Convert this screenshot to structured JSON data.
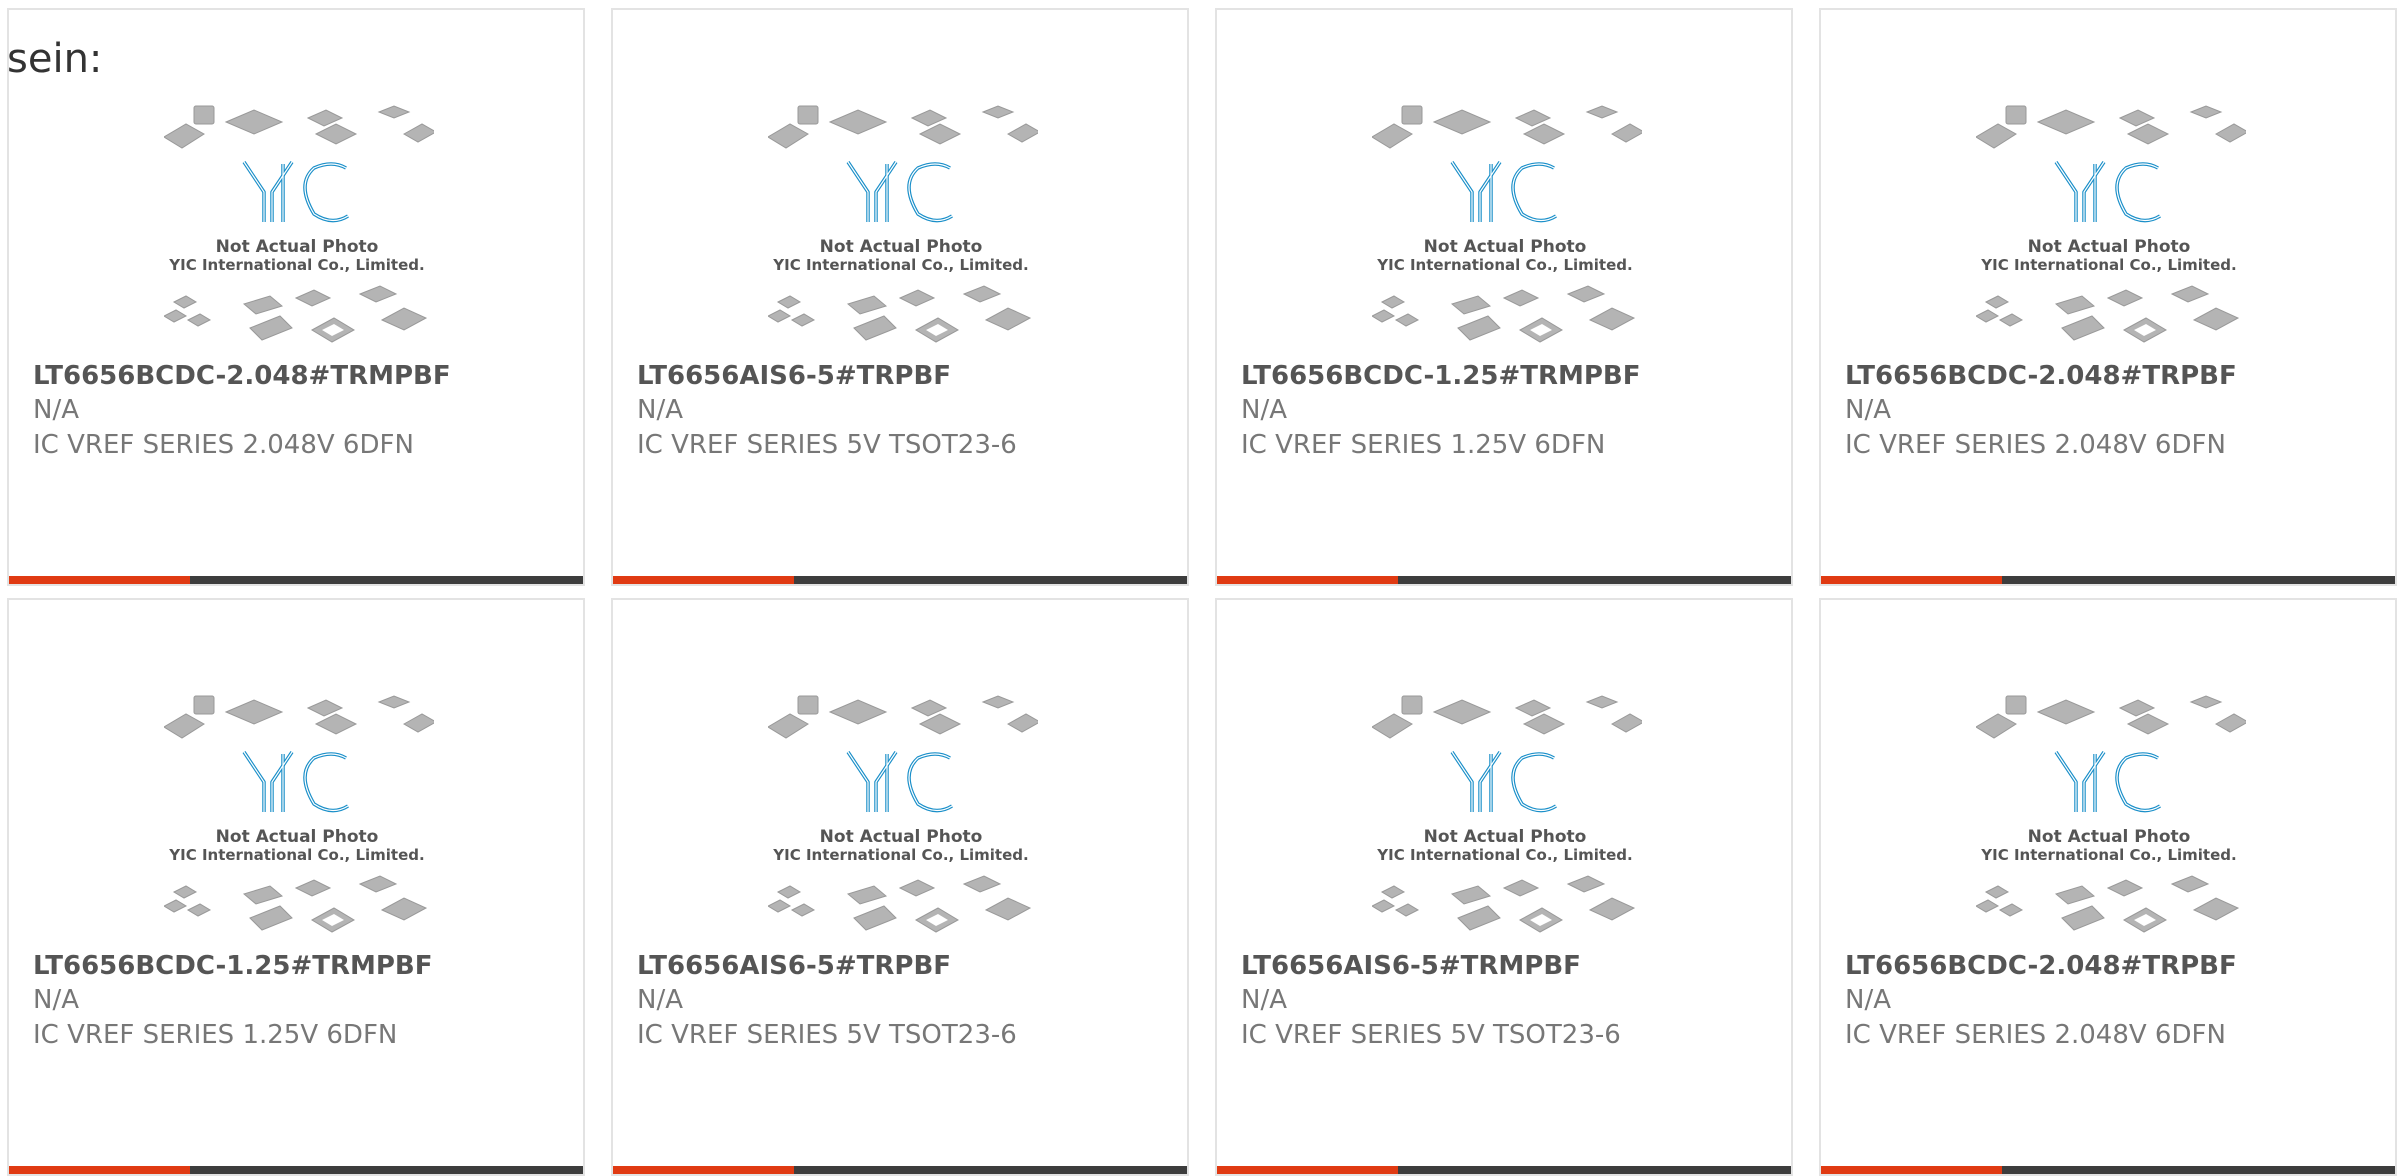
{
  "intro_text": "sein:",
  "photo": {
    "line1": "Not Actual Photo",
    "line2": "YIC International Co., Limited.",
    "logo_text": "YIC",
    "logo_color": "#1a8fc9"
  },
  "colors": {
    "accent": "#e03a12",
    "bar": "#3d3d3d",
    "card_border": "#e3e3e3"
  },
  "products": [
    {
      "part": "LT6656BCDC-2.048#TRMPBF",
      "manufacturer": "N/A",
      "description": "IC VREF SERIES 2.048V 6DFN"
    },
    {
      "part": "LT6656AIS6-5#TRPBF",
      "manufacturer": "N/A",
      "description": "IC VREF SERIES 5V TSOT23-6"
    },
    {
      "part": "LT6656BCDC-1.25#TRMPBF",
      "manufacturer": "N/A",
      "description": "IC VREF SERIES 1.25V 6DFN"
    },
    {
      "part": "LT6656BCDC-2.048#TRPBF",
      "manufacturer": "N/A",
      "description": "IC VREF SERIES 2.048V 6DFN"
    },
    {
      "part": "LT6656BCDC-1.25#TRMPBF",
      "manufacturer": "N/A",
      "description": "IC VREF SERIES 1.25V 6DFN"
    },
    {
      "part": "LT6656AIS6-5#TRPBF",
      "manufacturer": "N/A",
      "description": "IC VREF SERIES 5V TSOT23-6"
    },
    {
      "part": "LT6656AIS6-5#TRMPBF",
      "manufacturer": "N/A",
      "description": "IC VREF SERIES 5V TSOT23-6"
    },
    {
      "part": "LT6656BCDC-2.048#TRPBF",
      "manufacturer": "N/A",
      "description": "IC VREF SERIES 2.048V 6DFN"
    }
  ]
}
